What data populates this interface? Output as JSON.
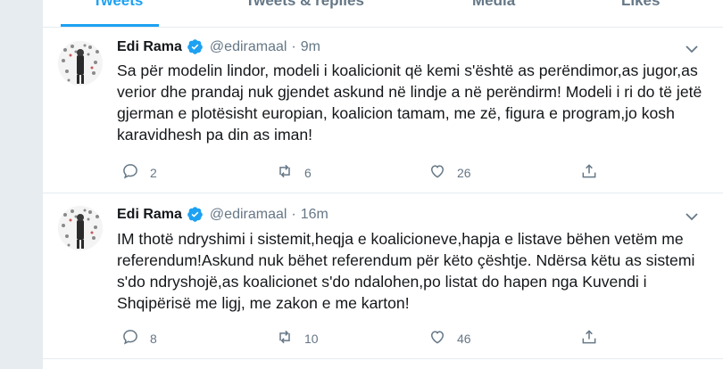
{
  "tabs": [
    {
      "label": "Tweets",
      "active": true
    },
    {
      "label": "Tweets & replies",
      "active": false
    },
    {
      "label": "Media",
      "active": false
    },
    {
      "label": "Likes",
      "active": false
    }
  ],
  "colors": {
    "accent": "#1da1f2",
    "muted": "#657786",
    "text": "#14171a",
    "background": "#e6ecf0"
  },
  "tweets": [
    {
      "name": "Edi Rama",
      "handle": "@ediramaal",
      "separator": "·",
      "time": "9m",
      "text": "Sa për modelin lindor, modeli i koalicionit që kemi s'është as perëndimor,as jugor,as verior dhe prandaj nuk gjendet askund në lindje a në perëndirm! Modeli i ri do të jetë gjerman e plotësisht europian, koalicion tamam, me zë, figura e program,jo kosh karavidhesh pa din as iman!",
      "replies": "2",
      "retweets": "6",
      "likes": "26"
    },
    {
      "name": "Edi Rama",
      "handle": "@ediramaal",
      "separator": "·",
      "time": "16m",
      "text": "IM thotë ndryshimi i sistemit,heqja e koalicioneve,hapja e listave bëhen vetëm me referendum!Askund nuk bëhet referendum për këto çështje. Ndërsa këtu as sistemi s'do ndryshojë,as koalicionet s'do ndalohen,po listat do hapen nga Kuvendi i Shqipërisë me ligj, me zakon e me karton!",
      "replies": "8",
      "retweets": "10",
      "likes": "46"
    }
  ],
  "icons": {
    "verified": "verified-badge-icon",
    "caret": "chevron-down-icon",
    "reply": "reply-icon",
    "retweet": "retweet-icon",
    "like": "heart-icon",
    "share": "share-icon"
  }
}
